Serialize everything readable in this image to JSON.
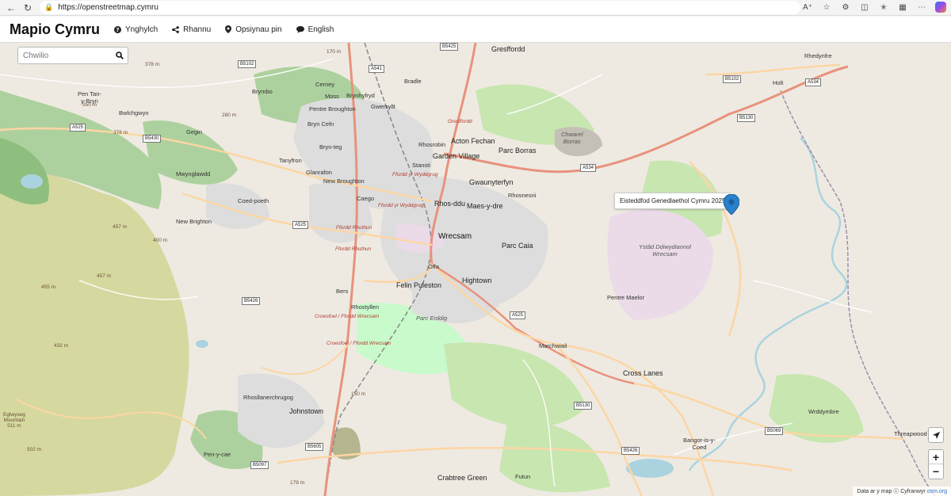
{
  "browser": {
    "url": "https://openstreetmap.cymru"
  },
  "header": {
    "title": "Mapio Cymru",
    "menu": {
      "help": "Ynghylch",
      "share": "Rhannu",
      "pin": "Opsiynau pin",
      "language": "English"
    }
  },
  "search": {
    "placeholder": "Chwilio"
  },
  "popup": {
    "text": "Eisteddfod Genedlaethol Cymru 2025"
  },
  "zoom": {
    "in": "+",
    "out": "−"
  },
  "attribution": {
    "text": "Data ar y map ⓒ Cyfranwyr",
    "link": "osm.org"
  },
  "map_labels": {
    "wrecsam": "Wrecsam",
    "gresffordd": "Gresffordd",
    "rhedynfre": "Rhedynfre",
    "holt": "Holt",
    "bradle": "Bradle",
    "cerney": "Cerney",
    "brymbo": "Brymbo",
    "moss": "Moss",
    "brynhyfryd": "Brynhyfryd",
    "gwersyllt": "Gwersyllt",
    "pentre_broughton": "Pentre Broughton",
    "bryn_cefn": "Bryn Cefn",
    "bwlchgwyn": "Bwlchgwyn",
    "pen_tan": "Pen Tan-\ny-Bryn",
    "gegin": "Gegin",
    "bryn_teg": "Bryn-teg",
    "tanyfron": "Tanyfron",
    "glanrafon": "Glanrafon",
    "mwynglawdd": "Mwynglawdd",
    "new_broughton": "New Broughton",
    "caego": "Caego",
    "coed_poeth": "Coed-poeth",
    "new_brighton": "New Brighton",
    "acton": "Acton Fechan",
    "rhosrobin": "Rhosrobin",
    "stansti": "Stansti",
    "garden_village": "Garden Village",
    "parc_borras": "Parc Borras",
    "chwarel_borras": "Chwarel\nBorras",
    "gwaunyterfyn": "Gwaunyterfyn",
    "rhos_ddu": "Rhos-ddu",
    "maes_y_dre": "Maes-y-dre",
    "rhosnesni": "Rhosnesni",
    "parc_caia": "Parc Caia",
    "offa": "Offa",
    "felin_puleston": "Felin Puleston",
    "hightown": "Hightown",
    "ystad": "Ystâd Ddiwydiannol\nWrecsam",
    "pentre_maelor": "Pentre Maelor",
    "bers": "Bers",
    "rhostyllen": "Rhostyllen",
    "parc_erddig": "Parc Erddig",
    "marchwiail": "Marchwiail",
    "cross_lanes": "Cross Lanes",
    "rhosllanerchrugog": "Rhosllanerchrugog",
    "johnstown": "Johnstown",
    "wrddymbre": "Wrddymbre",
    "bangor": "Bangor-is-y-\nCoed",
    "threapwood": "Threapwood",
    "pen_y_cae": "Pen-y-cae",
    "crabtree_green": "Crabtree Green",
    "eglwyseg": "Eglwyseg\nMountain\n511 m",
    "ffordd_yr_wyddgrug_1": "Ffordd yr Wyddgrug",
    "ffordd_yr_wyddgrug_2": "Ffordd yr Wyddgrug",
    "ffordd_rhuthun_1": "Ffordd Rhuthun",
    "ffordd_rhuthun_2": "Ffordd Rhuthun",
    "croesfoel_1": "Croesfoel / Ffordd Wrecsam",
    "croesfoel_2": "Croesfoel / Ffordd Wrecsam",
    "gresffordd_road": "Gresffordd",
    "h457a": "457 m",
    "h457b": "457 m",
    "h400": "400 m",
    "h455": "455 m",
    "h432": "432 m",
    "h502": "502 m",
    "h378a": "378 m",
    "h378b": "378 m",
    "h350": "350 m",
    "h280": "280 m",
    "h150": "150 m",
    "h179": "179 m",
    "h170": "170 m",
    "futun": "Futun"
  },
  "road_shields": {
    "a541": "A541",
    "b5102a": "B5102",
    "b5425": "B5425",
    "b5102b": "B5102",
    "a534a": "A534",
    "b5130a": "B5130",
    "a525a": "A525",
    "b5430": "B5430",
    "a534b": "A534",
    "a525b": "A525",
    "b5426a": "B5426",
    "a525c": "A525",
    "b5130b": "B5130",
    "b5069": "B5069",
    "b5426b": "B5426",
    "b5605": "B5605",
    "b5097": "B5097"
  },
  "colors": {
    "land": "#eeeae2",
    "forest": "#add19e",
    "park": "#c8facc",
    "urban": "#dddddd",
    "industrial": "#ebdbe8",
    "heath": "#d6d99f",
    "primary_road": "#fcd6a4",
    "trunk_road": "#f9b29c",
    "water": "#aad3df",
    "marker": "#2a81cb"
  }
}
